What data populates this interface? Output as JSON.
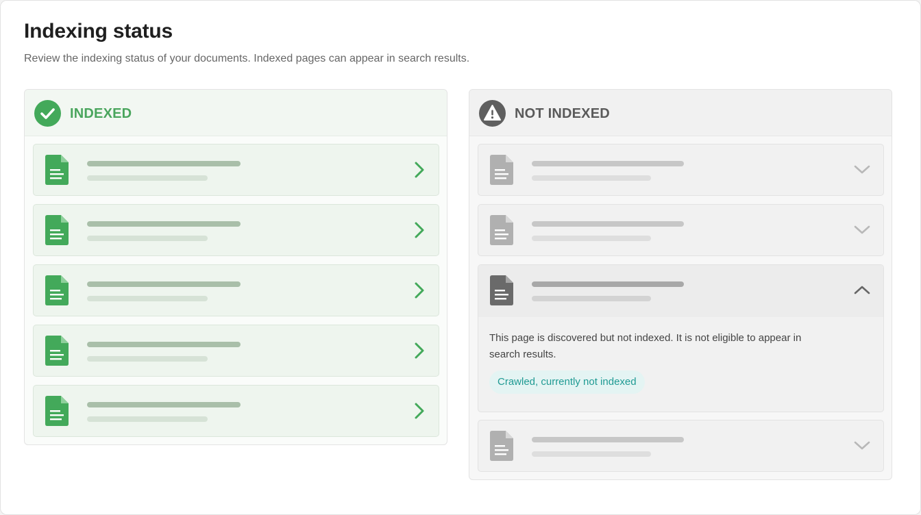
{
  "page": {
    "title": "Indexing status",
    "description": "Review the indexing status of your documents. Indexed pages can appear in search results."
  },
  "indexed_panel": {
    "label": "INDEXED",
    "icon": "check-circle-icon",
    "accent_color": "#43a95a",
    "row_count": 5
  },
  "not_indexed_panel": {
    "label": "NOT INDEXED",
    "icon": "warning-triangle-icon",
    "accent_color": "#5f5f5f",
    "row_count": 4,
    "expanded_row": {
      "message": "This page is discovered but not indexed. It is not eligible to appear in search results.",
      "status_badge": "Crawled, currently not indexed",
      "badge_color": "#1f9a93"
    }
  }
}
